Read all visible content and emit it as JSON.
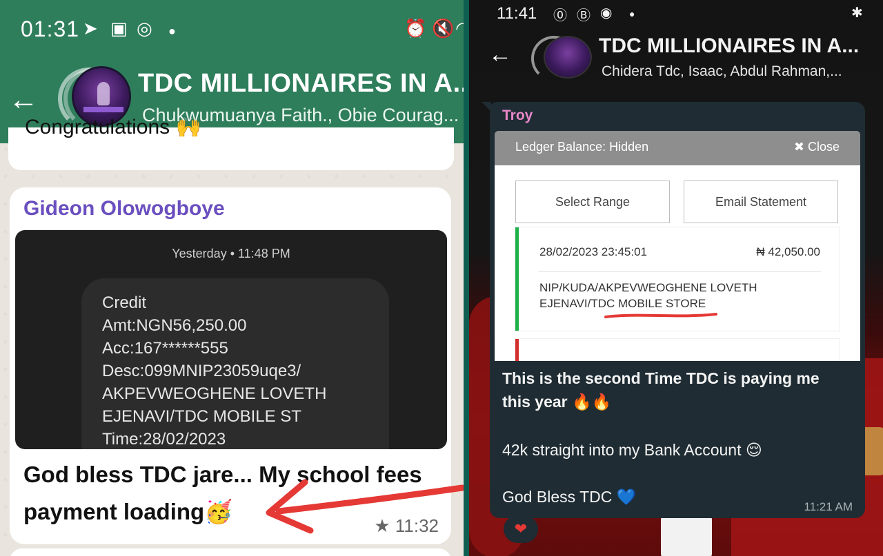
{
  "left": {
    "status": {
      "time": "01:31"
    },
    "header": {
      "title": "TDC MILLIONAIRES IN A...",
      "subtitle": "Chukwumuanya Faith.,  Obie Courag..."
    },
    "prev_message": {
      "text": "Congratulations 🙌"
    },
    "message": {
      "sender": "Gideon Olowogboye",
      "screenshot": {
        "stamp": "Yesterday • 11:48 PM",
        "lines": [
          "Credit",
          "Amt:NGN56,250.00",
          "Acc:167******555",
          "Desc:099MNIP23059uqe3/",
          "AKPEVWEOGHENE LOVETH",
          "EJENAVI/TDC MOBILE ST",
          "Time:28/02/2023"
        ]
      },
      "text_line1": "God bless TDC jare... My school fees",
      "text_line2": "payment loading🥳",
      "time": "★ 11:32"
    }
  },
  "right": {
    "status": {
      "time": "11:41"
    },
    "header": {
      "title": "TDC MILLIONAIRES IN A...",
      "subtitle": "Chidera Tdc,  Isaac, Abdul Rahman,..."
    },
    "message": {
      "sender": "Troy",
      "screenshot": {
        "ledger_label": "Ledger Balance: Hidden",
        "close_label": "✖ Close",
        "select_range": "Select Range",
        "email_statement": "Email Statement",
        "date": "28/02/2023 23:45:01",
        "amount": "₦ 42,050.00",
        "narration1": "NIP/KUDA/AKPEVWEOGHENE LOVETH",
        "narration2": "EJENAVI/TDC MOBILE STORE"
      },
      "line1": "This is the second Time TDC is paying me",
      "line2": "this year 🔥🔥",
      "line3": "42k straight into my Bank Account 😌",
      "line4": "God Bless TDC 💙",
      "time": "11:21 AM"
    },
    "reaction": "❤"
  },
  "colors": {
    "whatsapp_green": "#2e7d5b",
    "sender_purple": "#6b4fbf",
    "sender_pink": "#e887c9",
    "dark_bubble": "#1f2c33",
    "arrow_red": "#e53935"
  }
}
